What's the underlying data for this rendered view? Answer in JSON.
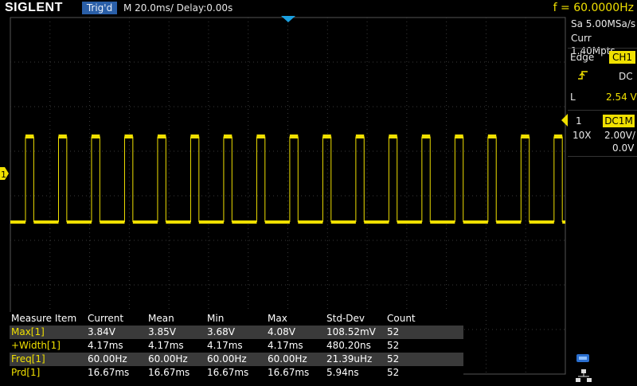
{
  "topbar": {
    "logo": "SIGLENT",
    "trigger_status": "Trig'd",
    "timebase": "M 20.0ms/ Delay:0.00s",
    "frequency": "f = 60.0000Hz"
  },
  "acquisition": {
    "sample_rate": "Sa 5.00MSa/s",
    "memory_depth": "Curr 1.40Mpts"
  },
  "trigger": {
    "type": "Edge",
    "source": "CH1",
    "slope_icon": "rising-edge-icon",
    "coupling": "DC",
    "level_label": "L",
    "level": "2.54 V"
  },
  "channel": {
    "number": "1",
    "coupling": "DC1M",
    "probe": "10X",
    "scale": "2.00V/",
    "offset": "0.0V",
    "marker": "1"
  },
  "measure": {
    "headers": [
      "Measure Item",
      "Current",
      "Mean",
      "Min",
      "Max",
      "Std-Dev",
      "Count"
    ],
    "rows": [
      {
        "item": "Max[1]",
        "current": "3.84V",
        "mean": "3.85V",
        "min": "3.68V",
        "max": "4.08V",
        "stddev": "108.52mV",
        "count": "52"
      },
      {
        "item": "+Width[1]",
        "current": "4.17ms",
        "mean": "4.17ms",
        "min": "4.17ms",
        "max": "4.17ms",
        "stddev": "480.20ns",
        "count": "52"
      },
      {
        "item": "Freq[1]",
        "current": "60.00Hz",
        "mean": "60.00Hz",
        "min": "60.00Hz",
        "max": "60.00Hz",
        "stddev": "21.39uHz",
        "count": "52"
      },
      {
        "item": "Prd[1]",
        "current": "16.67ms",
        "mean": "16.67ms",
        "min": "16.67ms",
        "max": "16.67ms",
        "stddev": "5.94ns",
        "count": "52"
      }
    ]
  },
  "waveform": {
    "color": "#f0e000",
    "frequency_hz": 60,
    "pulse_width_ms": 4.17,
    "high_v": 3.84,
    "low_v": 0,
    "volts_per_div": 2.0,
    "ms_per_div": 20.0
  },
  "status_icons": [
    "usb-icon",
    "network-icon"
  ]
}
